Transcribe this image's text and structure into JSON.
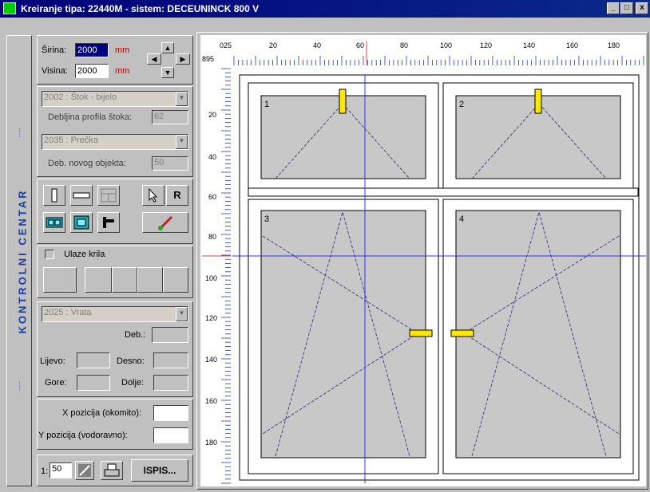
{
  "window": {
    "title": "Kreiranje tipa: 22440M - sistem: DECEUNINCK 800 V",
    "minimize_glyph": "_",
    "maximize_glyph": "□",
    "close_glyph": "x"
  },
  "side_panel": {
    "vertical_label": "KONTROLNI CENTAR",
    "dots": "....."
  },
  "dimensions": {
    "width_label": "Širina:",
    "width_value": "2000",
    "width_unit": "mm",
    "height_label": "Visina:",
    "height_value": "2000",
    "height_unit": "mm"
  },
  "profiles": {
    "frame_profile": "2002 : Štok - bijelo",
    "frame_thickness_label": "Debljina profila štoka:",
    "frame_thickness_value": "62",
    "mullion_profile": "2035 : Prečka",
    "new_object_thickness_label": "Deb. novog objekta:",
    "new_object_thickness_value": "50"
  },
  "tools": {
    "r_label": "R"
  },
  "sashes": {
    "checkbox_label": "Ulaze krila"
  },
  "door": {
    "profile": "2025 : Vrata",
    "thickness_label": "Deb.:",
    "left_label": "Lijevo:",
    "right_label": "Desno:",
    "top_label": "Gore:",
    "bottom_label": "Dolje:"
  },
  "position": {
    "x_label": "X pozicija (okomito):",
    "y_label": "Y pozicija (vodoravno):"
  },
  "bottom_bar": {
    "scale_prefix": "1:",
    "scale_value": "50",
    "print_button": "ISPIS..."
  },
  "ruler": {
    "corner_top": "025",
    "corner_left": "895",
    "top_labels": [
      "20",
      "40",
      "60",
      "80",
      "100",
      "120",
      "140",
      "160",
      "180"
    ],
    "left_labels": [
      "20",
      "40",
      "60",
      "80",
      "100",
      "120",
      "140",
      "160",
      "180"
    ]
  },
  "panes": [
    {
      "number": "1"
    },
    {
      "number": "2"
    },
    {
      "number": "3"
    },
    {
      "number": "4"
    }
  ],
  "colors": {
    "title_bar": "#00007a",
    "handle": "#ffe800",
    "crosshair": "#3030ff",
    "vertical_text": "#1a3aa8"
  }
}
